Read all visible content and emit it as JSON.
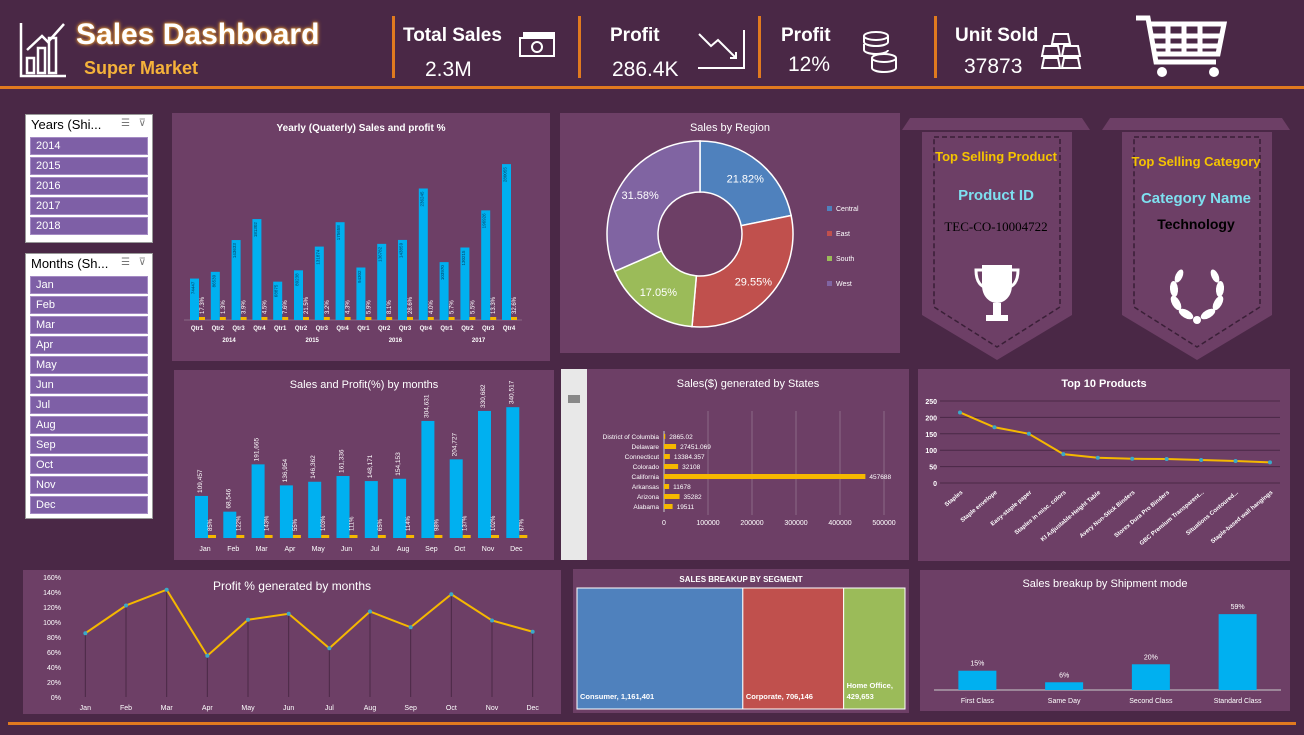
{
  "header": {
    "title": "Sales Dashboard",
    "subtitle": "Super Market",
    "kpis": [
      {
        "label": "Total Sales",
        "value": "2.3M",
        "icon": "cash-icon"
      },
      {
        "label": "Profit",
        "value": "286.4K",
        "icon": "declining-chart-icon"
      },
      {
        "label": "Profit",
        "value": "12%",
        "icon": "coins-icon"
      },
      {
        "label": "Unit Sold",
        "value": "37873",
        "icon": "gold-bars-icon"
      }
    ]
  },
  "slicers": {
    "years": {
      "title": "Years (Shi...",
      "items": [
        "2014",
        "2015",
        "2016",
        "2017",
        "2018"
      ]
    },
    "months": {
      "title": "Months (Sh...",
      "items": [
        "Jan",
        "Feb",
        "Mar",
        "Apr",
        "May",
        "Jun",
        "Jul",
        "Aug",
        "Sep",
        "Oct",
        "Nov",
        "Dec"
      ]
    }
  },
  "top_product": {
    "heading": "Top Selling Product",
    "label": "Product ID",
    "value": "TEC-CO-10004722"
  },
  "top_category": {
    "heading": "Top Selling Category",
    "label": "Category Name",
    "value": "Technology"
  },
  "colors": {
    "accent": "#e07a1f",
    "bar": "#00b0f0",
    "line": "#f5b800",
    "panel": "#6d3f66",
    "bg": "#4a2846"
  },
  "chart_data": [
    {
      "id": "yearly",
      "type": "bar",
      "title": "Yearly (Quaterly) Sales and profit %",
      "years": [
        "2014",
        "2015",
        "2016",
        "2017"
      ],
      "categories": [
        "Qtr1",
        "Qtr2",
        "Qtr3",
        "Qtr4",
        "Qtr1",
        "Qtr2",
        "Qtr3",
        "Qtr4",
        "Qtr1",
        "Qtr2",
        "Qtr3",
        "Qtr4",
        "Qtr1",
        "Qtr2",
        "Qtr3",
        "Qtr4"
      ],
      "series": [
        {
          "name": "Sales",
          "values": [
            74447,
            86539,
            143633,
            181302,
            68875,
            89238,
            131874,
            175658,
            94302,
            136782,
            143859,
            236245,
            103970,
            130215,
            196926,
            280055
          ]
        },
        {
          "name": "Profit %",
          "values": [
            "17.3%",
            "1.3%",
            "3.9%",
            "4.5%",
            "7.6%",
            "21.5%",
            "3.2%",
            "4.3%",
            "5.9%",
            "8.1%",
            "28.6%",
            "4.0%",
            "5.7%",
            "5.5%",
            "13.3%",
            "32.6%"
          ]
        }
      ],
      "ylim": [
        0,
        300000
      ]
    },
    {
      "id": "region",
      "type": "pie",
      "title": "Sales by Region",
      "labels": [
        "Central",
        "East",
        "South",
        "West"
      ],
      "values": [
        21.82,
        29.55,
        17.05,
        31.58
      ],
      "colors": [
        "#4f81bd",
        "#c0504d",
        "#9bbb59",
        "#8064a2"
      ],
      "legend": "right"
    },
    {
      "id": "months",
      "type": "bar",
      "title": "Sales and Profit(%) by months",
      "categories": [
        "Jan",
        "Feb",
        "Mar",
        "Apr",
        "May",
        "Jun",
        "Jul",
        "Aug",
        "Sep",
        "Oct",
        "Nov",
        "Dec"
      ],
      "series": [
        {
          "name": "Sales",
          "values": [
            109457,
            68546,
            191665,
            136954,
            146362,
            161336,
            148171,
            154153,
            304631,
            204727,
            330682,
            340517
          ]
        },
        {
          "name": "Profit %",
          "values": [
            "85%",
            "122%",
            "143%",
            "55%",
            "103%",
            "111%",
            "65%",
            "114%",
            "98%",
            "137%",
            "102%",
            "87%"
          ]
        }
      ],
      "labels": [
        "109,457",
        "68,546",
        "191,665",
        "136,954",
        "146,362",
        "161,336",
        "148,171",
        "154,153",
        "304,631",
        "204,727",
        "330,682",
        "340,517"
      ],
      "ylim": [
        0,
        380000
      ]
    },
    {
      "id": "states",
      "type": "bar",
      "title": "Sales($) generated by States",
      "categories": [
        "District of Columbia",
        "Delaware",
        "Connecticut",
        "Colorado",
        "California",
        "Arkansas",
        "Arizona",
        "Alabama"
      ],
      "values": [
        2865.02,
        27451.069,
        13384.357,
        32108,
        457688,
        11678,
        35282,
        19511
      ],
      "labels": [
        "2865.02",
        "27451.069",
        "13384.357",
        "32108",
        "457688",
        "11678",
        "35282",
        "19511"
      ],
      "xticks": [
        "0",
        "100000",
        "200000",
        "300000",
        "400000",
        "500000"
      ],
      "xlim": [
        0,
        500000
      ]
    },
    {
      "id": "top10",
      "type": "line",
      "title": "Top 10 Products",
      "categories": [
        "Staples",
        "Staple envelope",
        "Easy-staple paper",
        "Staples in misc. colors",
        "KI Adjustable-Height Table",
        "Avery Non-Stick Binders",
        "Storex Dura Pro Binders",
        "GBC Premium Transparent...",
        "Situations Contoured...",
        "Staple-based wall hangings"
      ],
      "values": [
        215,
        170,
        150,
        88,
        77,
        74,
        73,
        70,
        67,
        63
      ],
      "yticks": [
        "0",
        "50",
        "100",
        "150",
        "200",
        "250"
      ],
      "ylim": [
        0,
        250
      ]
    },
    {
      "id": "profit_months",
      "type": "line",
      "title": "Profit % generated by months",
      "categories": [
        "Jan",
        "Feb",
        "Mar",
        "Apr",
        "May",
        "Jun",
        "Jul",
        "Aug",
        "Sep",
        "Oct",
        "Nov",
        "Dec"
      ],
      "values": [
        85,
        122,
        143,
        55,
        103,
        111,
        65,
        114,
        93,
        137,
        102,
        87
      ],
      "yticks": [
        "0%",
        "20%",
        "40%",
        "60%",
        "80%",
        "100%",
        "120%",
        "140%",
        "160%"
      ],
      "ylim": [
        0,
        160
      ]
    },
    {
      "id": "segment",
      "type": "treemap",
      "title": "SALES BREAKUP BY SEGMENT",
      "labels": [
        "Consumer,  1,161,401",
        "Corporate,  706,146",
        "Home Office,\n429,653"
      ],
      "values": [
        1161401,
        706146,
        429653
      ],
      "colors": [
        "#4f81bd",
        "#c0504d",
        "#9bbb59"
      ]
    },
    {
      "id": "ship",
      "type": "bar",
      "title": "Sales breakup by Shipment mode",
      "categories": [
        "First Class",
        "Same Day",
        "Second Class",
        "Standard Class"
      ],
      "values": [
        15,
        6,
        20,
        59
      ],
      "labels": [
        "15%",
        "6%",
        "20%",
        "59%"
      ],
      "ylim": [
        0,
        70
      ]
    }
  ]
}
